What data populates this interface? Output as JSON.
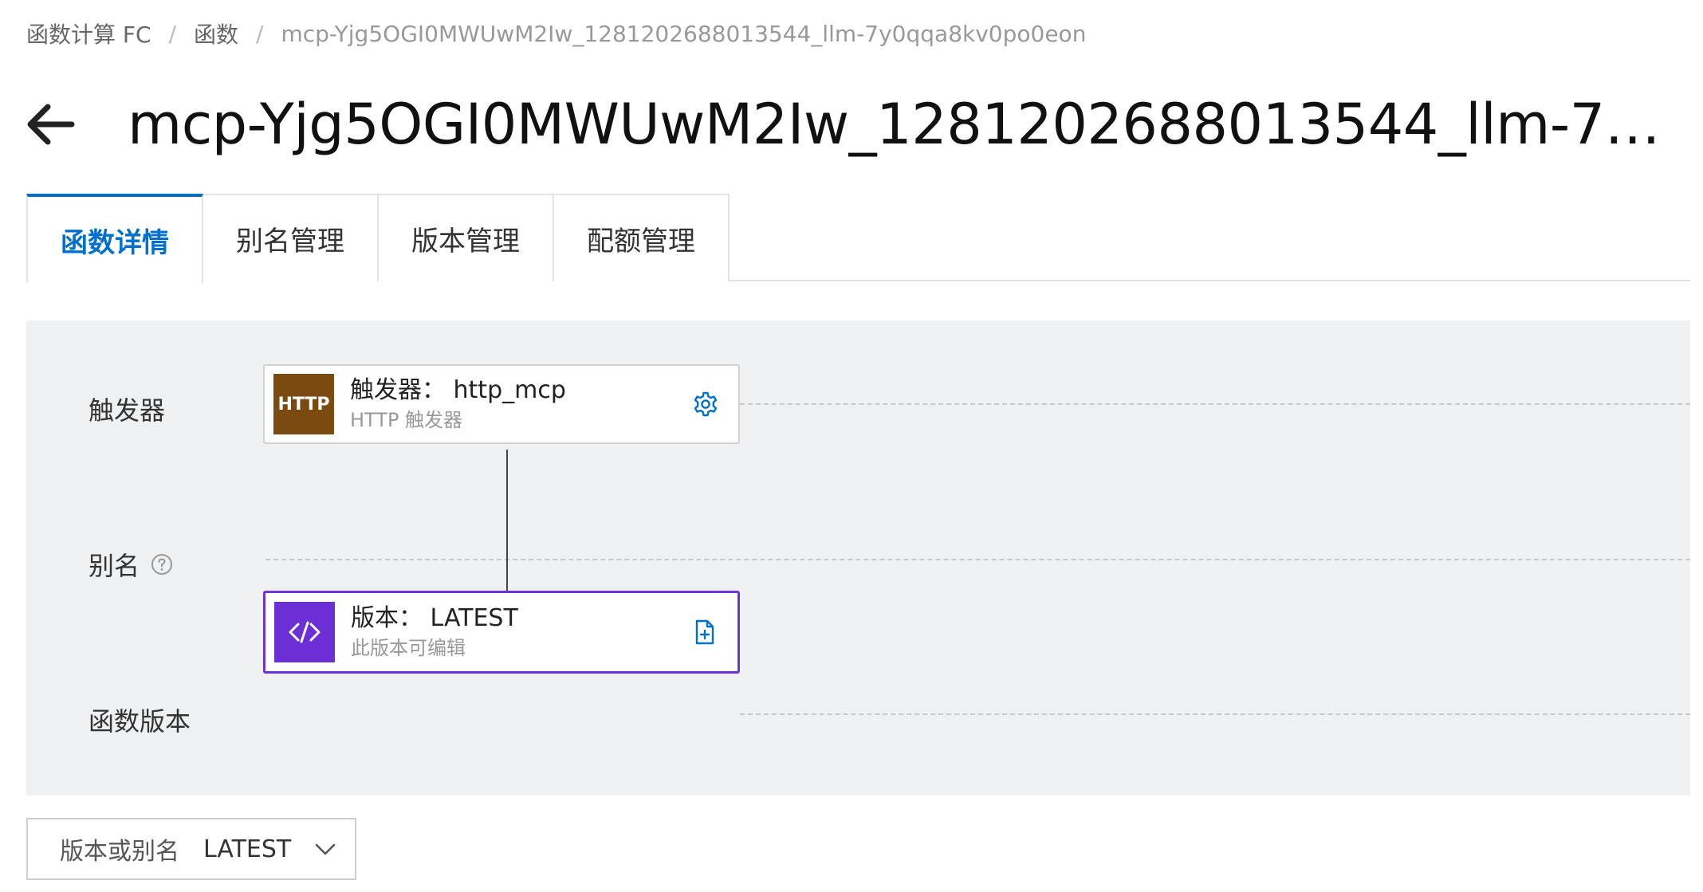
{
  "breadcrumb": {
    "items": [
      "函数计算 FC",
      "函数",
      "mcp-Yjg5OGI0MWUwM2Iw_1281202688013544_llm-7y0qqa8kv0po0eon"
    ],
    "separator": "/"
  },
  "header": {
    "title": "mcp-Yjg5OGI0MWUwM2Iw_1281202688013544_llm-7y0qq..."
  },
  "tabs": [
    {
      "label": "函数详情",
      "active": true
    },
    {
      "label": "别名管理",
      "active": false
    },
    {
      "label": "版本管理",
      "active": false
    },
    {
      "label": "配额管理",
      "active": false
    }
  ],
  "flow": {
    "rows": {
      "trigger": "触发器",
      "alias": "别名",
      "version": "函数版本"
    },
    "trigger_node": {
      "badge": "HTTP",
      "title": "触发器：  http_mcp",
      "subtitle": "HTTP 触发器",
      "action_icon": "gear-icon"
    },
    "version_node": {
      "title": "版本：  LATEST",
      "subtitle": "此版本可编辑",
      "action_icon": "file-plus-icon"
    }
  },
  "version_select": {
    "label": "版本或别名",
    "value": "LATEST"
  },
  "colors": {
    "accent": "#0070cc",
    "http_badge": "#7a4a10",
    "version_badge": "#6c2fd6",
    "version_border": "#6b34d9",
    "panel_bg": "#eff0f2"
  }
}
